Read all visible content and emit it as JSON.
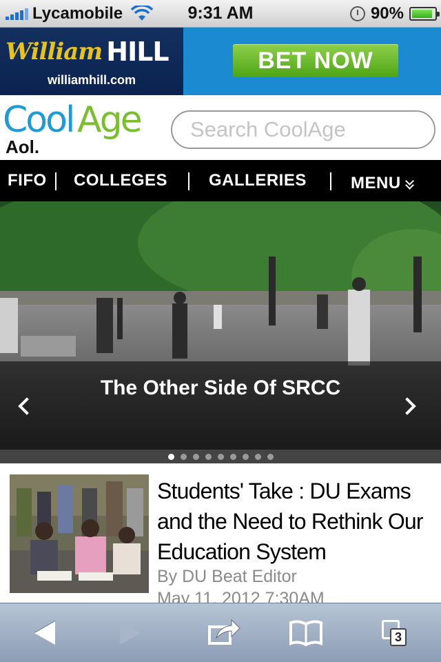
{
  "status_bar": {
    "carrier": "Lycamobile",
    "time": "9:31 AM",
    "battery": "90%",
    "battery_level": 0.9
  },
  "ad": {
    "brand_script": "William",
    "brand_word": "HILL",
    "url": "williamhill.com",
    "cta": "BET NOW"
  },
  "header": {
    "logo_cool": "Cool",
    "logo_age": "Age",
    "logo_aol": "Aol.",
    "search_placeholder": "Search CoolAge"
  },
  "nav": {
    "items": [
      "FIFO",
      "COLLEGES",
      "GALLERIES"
    ],
    "menu": "MENU"
  },
  "slider": {
    "caption": "The Other Side Of SRCC",
    "slide_count": 9,
    "active_index": 0
  },
  "article": {
    "title": "Students' Take : DU Exams and the Need to Rethink Our Education System",
    "author": "By DU Beat Editor",
    "date": "May 11, 2012 7:30AM"
  },
  "toolbar": {
    "tab_count": "3"
  },
  "colors": {
    "nav_bg": "#000000",
    "ad_bg": "#1b8ad1",
    "cta_green": "#4ea516",
    "cool_blue": "#1e9bd7",
    "age_green": "#7bbf30"
  }
}
